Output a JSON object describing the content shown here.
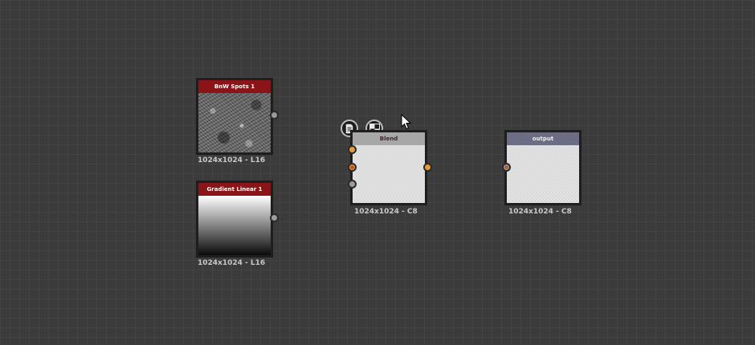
{
  "nodes": {
    "bnw_spots": {
      "title": "BnW Spots 1",
      "resolution": "1024x1024 - L16"
    },
    "gradient_linear": {
      "title": "Gradient Linear 1",
      "resolution": "1024x1024 - L16"
    },
    "blend": {
      "title": "Blend",
      "resolution": "1024x1024 - C8"
    },
    "output": {
      "title": "output",
      "resolution": "1024x1024 - C8"
    }
  },
  "toolbar": {
    "icons": [
      "document-icon",
      "checker-icon"
    ]
  },
  "colors": {
    "header_red": "#8a1418",
    "header_gray": "#a7a7a7",
    "header_output": "#6c6c84",
    "port_orange": "#e99a37",
    "port_gray": "#9c9c9c"
  }
}
